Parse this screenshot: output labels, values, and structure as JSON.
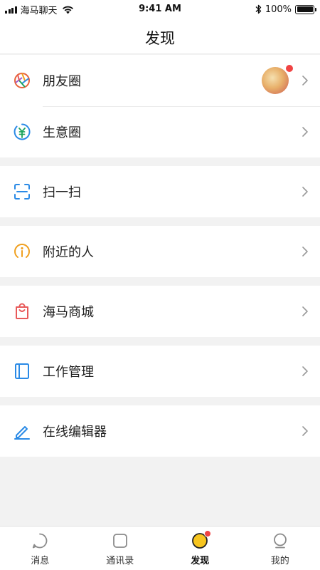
{
  "status_bar": {
    "carrier": "海马聊天",
    "time": "9:41 AM",
    "battery": "100%",
    "battery_level": 1.0
  },
  "nav": {
    "title": "发现"
  },
  "menu": {
    "groups": [
      {
        "items": [
          {
            "label": "朋友圈",
            "icon": "moments-icon",
            "color": "#e8643c",
            "has_thumbnail": true,
            "has_badge": true
          },
          {
            "label": "生意圈",
            "icon": "business-circle-icon",
            "color": "#1aa35c"
          }
        ]
      },
      {
        "items": [
          {
            "label": "扫一扫",
            "icon": "scan-icon",
            "color": "#2a8ae6"
          }
        ]
      },
      {
        "items": [
          {
            "label": "附近的人",
            "icon": "nearby-icon",
            "color": "#f0a020"
          }
        ]
      },
      {
        "items": [
          {
            "label": "海马商城",
            "icon": "shopping-bag-icon",
            "color": "#e85a5a"
          }
        ]
      },
      {
        "items": [
          {
            "label": "工作管理",
            "icon": "work-book-icon",
            "color": "#2a8ae6"
          }
        ]
      },
      {
        "items": [
          {
            "label": "在线编辑器",
            "icon": "edit-pen-icon",
            "color": "#2a8ae6"
          }
        ]
      }
    ]
  },
  "tab_bar": {
    "tabs": [
      {
        "label": "消息",
        "icon": "message-icon",
        "active": false
      },
      {
        "label": "通讯录",
        "icon": "contacts-icon",
        "active": false
      },
      {
        "label": "发现",
        "icon": "discover-icon",
        "active": true,
        "badge": true
      },
      {
        "label": "我的",
        "icon": "profile-icon",
        "active": false
      }
    ]
  }
}
